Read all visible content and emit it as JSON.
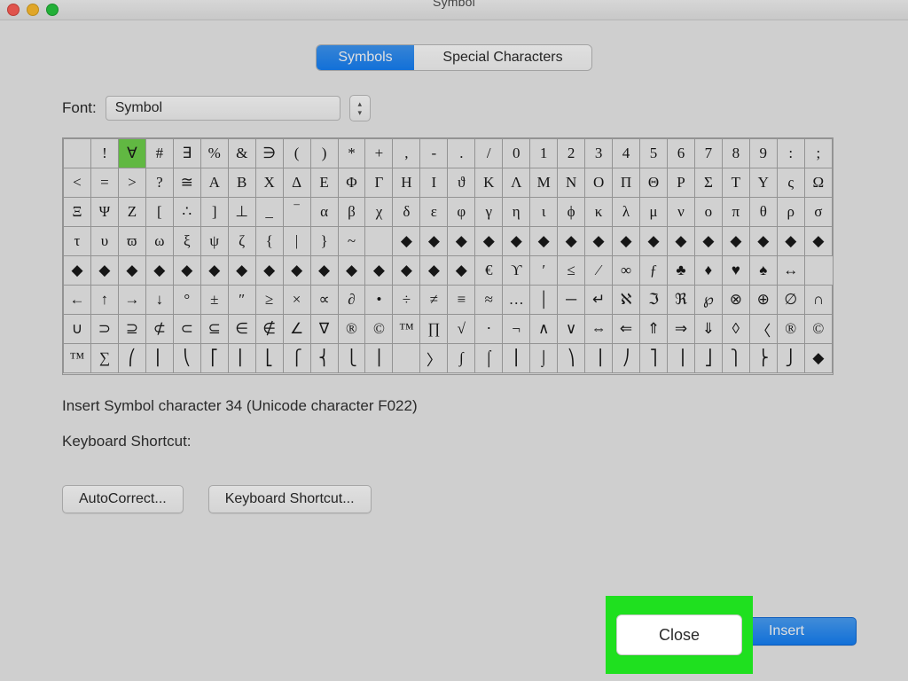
{
  "window": {
    "title": "Symbol"
  },
  "tabs": {
    "symbols": "Symbols",
    "special": "Special Characters"
  },
  "font": {
    "label": "Font:",
    "value": "Symbol"
  },
  "grid": {
    "selectedRow": 0,
    "selectedCol": 2,
    "rows": [
      [
        " ",
        "!",
        "∀",
        "#",
        "∃",
        "%",
        "&",
        "∋",
        "(",
        ")",
        "*",
        "+",
        ",",
        "-",
        ".",
        "/",
        "0",
        "1",
        "2",
        "3",
        "4",
        "5",
        "6",
        "7",
        "8",
        "9",
        ":",
        ";"
      ],
      [
        "<",
        "=",
        ">",
        "?",
        "≅",
        "Α",
        "Β",
        "Χ",
        "Δ",
        "Ε",
        "Φ",
        "Γ",
        "Η",
        "Ι",
        "ϑ",
        "Κ",
        "Λ",
        "Μ",
        "Ν",
        "Ο",
        "Π",
        "Θ",
        "Ρ",
        "Σ",
        "Τ",
        "Υ",
        "ς",
        "Ω"
      ],
      [
        "Ξ",
        "Ψ",
        "Ζ",
        "[",
        "∴",
        "]",
        "⊥",
        "_",
        "‾",
        "α",
        "β",
        "χ",
        "δ",
        "ε",
        "φ",
        "γ",
        "η",
        "ι",
        "ϕ",
        "κ",
        "λ",
        "μ",
        "ν",
        "ο",
        "π",
        "θ",
        "ρ",
        "σ"
      ],
      [
        "τ",
        "υ",
        "ϖ",
        "ω",
        "ξ",
        "ψ",
        "ζ",
        "{",
        "|",
        "}",
        "~",
        "",
        "◆",
        "◆",
        "◆",
        "◆",
        "◆",
        "◆",
        "◆",
        "◆",
        "◆",
        "◆",
        "◆",
        "◆",
        "◆",
        "◆",
        "◆",
        "◆"
      ],
      [
        "◆",
        "◆",
        "◆",
        "◆",
        "◆",
        "◆",
        "◆",
        "◆",
        "◆",
        "◆",
        "◆",
        "◆",
        "◆",
        "◆",
        "◆",
        "€",
        "ϒ",
        "′",
        "≤",
        "⁄",
        "∞",
        "ƒ",
        "♣",
        "♦",
        "♥",
        "♠",
        "↔"
      ],
      [
        "←",
        "↑",
        "→",
        "↓",
        "°",
        "±",
        "″",
        "≥",
        "×",
        "∝",
        "∂",
        "•",
        "÷",
        "≠",
        "≡",
        "≈",
        "…",
        "│",
        "─",
        "↵",
        "ℵ",
        "ℑ",
        "ℜ",
        "℘",
        "⊗",
        "⊕",
        "∅",
        "∩"
      ],
      [
        "∪",
        "⊃",
        "⊇",
        "⊄",
        "⊂",
        "⊆",
        "∈",
        "∉",
        "∠",
        "∇",
        "®",
        "©",
        "™",
        "∏",
        "√",
        "⋅",
        "¬",
        "∧",
        "∨",
        "⇔",
        "⇐",
        "⇑",
        "⇒",
        "⇓",
        "◊",
        "〈",
        "®",
        "©"
      ],
      [
        "™",
        "∑",
        "⎛",
        "⎜",
        "⎝",
        "⎡",
        "⎢",
        "⎣",
        "⎧",
        "⎨",
        "⎩",
        "⎪",
        "",
        "〉",
        "∫",
        "⌠",
        "⎮",
        "⌡",
        "⎞",
        "⎟",
        "⎠",
        "⎤",
        "⎥",
        "⎦",
        "⎫",
        "⎬",
        "⎭",
        "◆"
      ]
    ]
  },
  "info": {
    "line1": "Insert Symbol character 34  (Unicode character F022)",
    "line2_label": "Keyboard Shortcut:"
  },
  "buttons": {
    "autocorrect": "AutoCorrect...",
    "keyboard_shortcut": "Keyboard Shortcut...",
    "close": "Close",
    "insert": "Insert"
  }
}
